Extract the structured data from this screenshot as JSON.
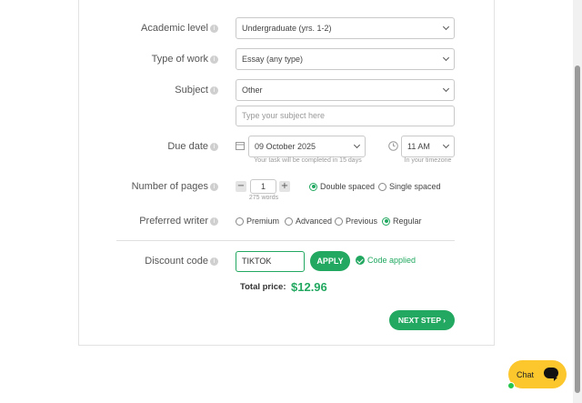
{
  "form": {
    "academic_level": {
      "label": "Academic level",
      "value": "Undergraduate (yrs. 1-2)"
    },
    "type_of_work": {
      "label": "Type of work",
      "value": "Essay (any type)"
    },
    "subject": {
      "label": "Subject",
      "value": "Other",
      "placeholder": "Type your subject here"
    },
    "due_date": {
      "label": "Due date",
      "date": "09 October 2025",
      "date_hint": "Your task will be completed in 15 days",
      "time": "11 AM",
      "time_hint": "In your timezone"
    },
    "pages": {
      "label": "Number of pages",
      "value": "1",
      "words": "275 words",
      "minus": "−",
      "plus": "+",
      "spacing_options": [
        "Double spaced",
        "Single spaced"
      ],
      "selected_spacing": "Double spaced"
    },
    "writer": {
      "label": "Preferred writer",
      "options": [
        "Premium",
        "Advanced",
        "Previous",
        "Regular"
      ],
      "selected": "Regular"
    },
    "discount": {
      "label": "Discount code",
      "value": "TIKTOK",
      "apply_label": "APPLY",
      "status": "Code applied"
    },
    "total": {
      "label": "Total price:",
      "value": "$12.96"
    },
    "next_label": "NEXT STEP ›"
  },
  "chat": {
    "label": "Chat"
  },
  "colors": {
    "accent": "#22a860",
    "chat": "#fcc62d"
  },
  "icons": {
    "info": "info-icon",
    "calendar": "calendar-icon",
    "clock": "clock-icon",
    "check": "check-circle-icon",
    "chat": "chat-bubble-icon"
  }
}
